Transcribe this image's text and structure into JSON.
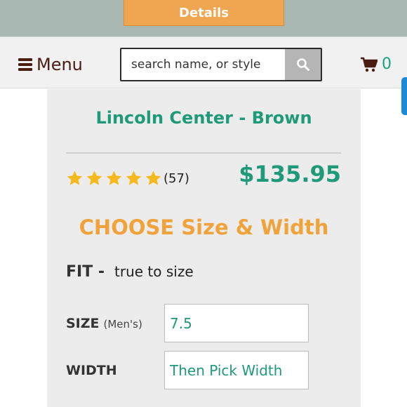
{
  "top": {
    "details_label": "Details"
  },
  "header": {
    "menu_label": "Menu",
    "search": {
      "placeholder": "search name, or style"
    },
    "cart_count": "0"
  },
  "product": {
    "title": "Lincoln Center - Brown",
    "rating": {
      "stars": 5,
      "max": 5,
      "review_count": "(57)"
    },
    "price": "$135.95"
  },
  "selection": {
    "heading": "CHOOSE Size & Width",
    "fit": {
      "label": "FIT -",
      "value": "true to size"
    },
    "size": {
      "label": "SIZE",
      "sub": "(Men's)",
      "value": "7.5"
    },
    "width": {
      "label": "WIDTH",
      "value": "Then Pick Width"
    }
  },
  "colors": {
    "accent_orange": "#f0a33a",
    "accent_green": "#1f9a78",
    "brand_brown": "#4a1c12",
    "star_yellow": "#f6b91c"
  },
  "icons": [
    "hamburger-icon",
    "search-icon",
    "cart-icon",
    "star-icon"
  ]
}
